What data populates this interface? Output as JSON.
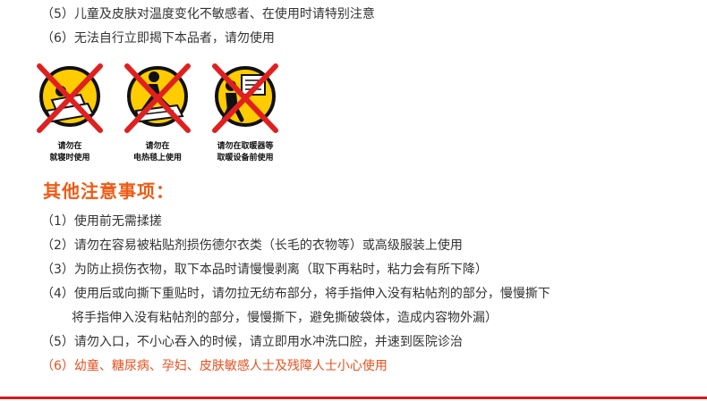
{
  "colors": {
    "accent": "#ef5a14",
    "highlight": "#e8501e",
    "bar": "#cf1b1b",
    "warn_yellow": "#ffcc00",
    "warn_red": "#e02020"
  },
  "top_items": [
    "（5）儿童及皮肤对温度变化不敏感者、在使用时请特别注意",
    "（6）无法自行立即揭下本品者，请勿使用"
  ],
  "warnings": [
    {
      "icon": "no-bed-icon",
      "line1": "请勿在",
      "line2": "就寝时使用"
    },
    {
      "icon": "no-heating-pad-icon",
      "line1": "请勿在",
      "line2": "电热毯上使用"
    },
    {
      "icon": "no-heater-icon",
      "line1": "请勿在取暖器等",
      "line2": "取暖设备前使用"
    }
  ],
  "section_title": "其他注意事项：",
  "other_items": [
    "（1）使用前无需揉搓",
    "（2）请勿在容易被粘贴剂损伤德尔衣类（长毛的衣物等）或高级服装上使用",
    "（3）为防止损伤衣物，取下本品时请慢慢剥离（取下再粘时，粘力会有所下降）",
    "（4）使用后或向撕下重贴时，请勿拉无纺布部分，将手指伸入没有粘帖剂的部分，慢慢撕下",
    "将手指伸入没有粘帖剂的部分，慢慢撕下，避免撕破袋体，造成内容物外漏）",
    "（5）请勿入口，不小心吞入的时候，请立即用水冲洗口腔，并速到医院诊治",
    "（6）幼童、糖尿病、孕妇、皮肤敏感人士及残障人士小心使用"
  ]
}
